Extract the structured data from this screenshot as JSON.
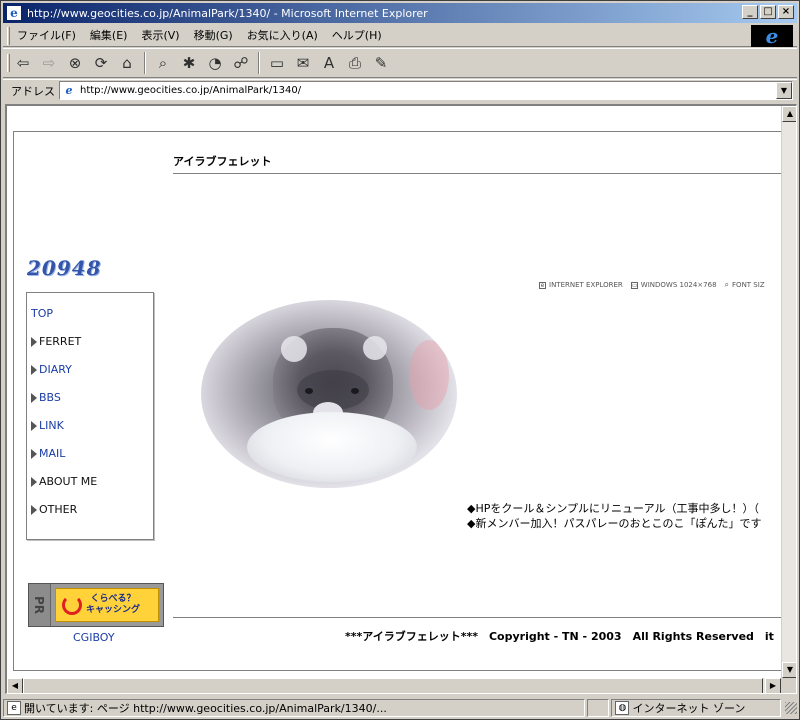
{
  "window": {
    "title": "http://www.geocities.co.jp/AnimalPark/1340/ - Microsoft Internet Explorer",
    "minimize": "_",
    "maximize": "□",
    "close": "×"
  },
  "menu": {
    "items": [
      "ファイル(F)",
      "編集(E)",
      "表示(V)",
      "移動(G)",
      "お気に入り(A)",
      "ヘルプ(H)"
    ]
  },
  "address": {
    "label": "アドレス",
    "url": "http://www.geocities.co.jp/AnimalPark/1340/"
  },
  "page": {
    "site_title": "アイラブフェレット",
    "counter": "20948",
    "info": [
      "INTERNET EXPLORER",
      "WINDOWS 1024×768",
      "FONT SIZ"
    ],
    "nav": [
      {
        "label": "TOP",
        "arrow": false,
        "link": true
      },
      {
        "label": "FERRET",
        "arrow": true,
        "link": false
      },
      {
        "label": "DIARY",
        "arrow": true,
        "link": true
      },
      {
        "label": "BBS",
        "arrow": true,
        "link": true
      },
      {
        "label": "LINK",
        "arrow": true,
        "link": true
      },
      {
        "label": "MAIL",
        "arrow": true,
        "link": true
      },
      {
        "label": "ABOUT ME",
        "arrow": true,
        "link": false
      },
      {
        "label": "OTHER",
        "arrow": true,
        "link": false
      }
    ],
    "news": [
      "◆HPをクール＆シンプルにリニューアル（工事中多し！）（",
      "◆新メンバー加入！パスパレーのおとこのこ「ぽんた」です"
    ],
    "pr": {
      "side": "PR",
      "line1": "くらべる？",
      "line2": "キャッシング"
    },
    "cgiboy": "CGIBOY",
    "footer": "***アイラブフェレット***　Copyright - TN - 2003　All Rights Reserved　it"
  },
  "status": {
    "text": "開いています: ページ http://www.geocities.co.jp/AnimalPark/1340/...",
    "zone": "インターネット ゾーン"
  },
  "colors": {
    "title_gradient_start": "#0a246a",
    "title_gradient_end": "#a6caf0",
    "link": "#1a3ca8",
    "counter": "#3355aa",
    "pr_yellow": "#ffd23a"
  }
}
